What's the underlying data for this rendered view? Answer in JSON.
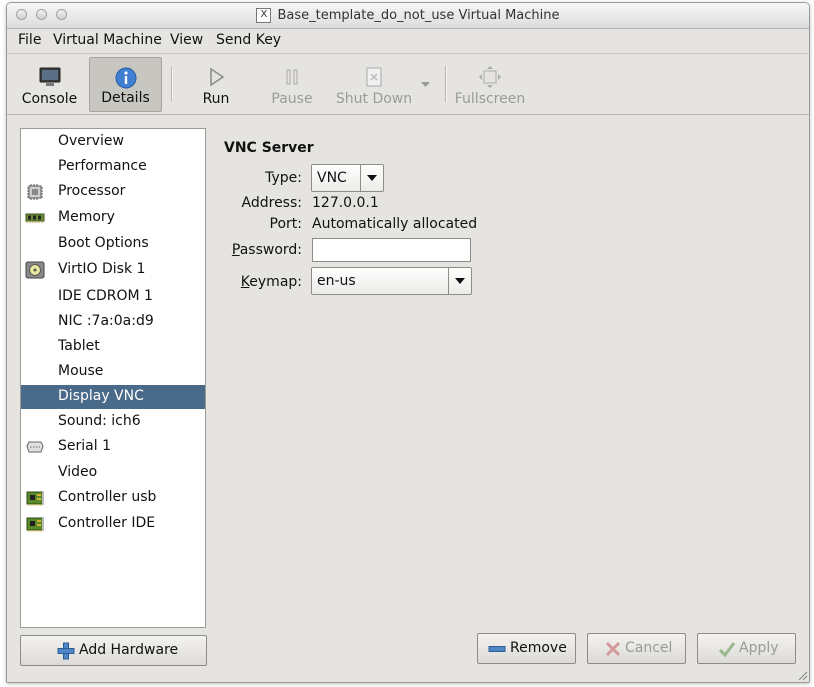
{
  "window": {
    "title": "Base_template_do_not_use Virtual Machine",
    "x_icon": "X"
  },
  "menu": {
    "file": "File",
    "virtual_machine": "Virtual Machine",
    "view": "View",
    "send_key": "Send Key"
  },
  "toolbar": {
    "console": "Console",
    "details": "Details",
    "run": "Run",
    "pause": "Pause",
    "shut_down": "Shut Down",
    "fullscreen": "Fullscreen"
  },
  "sidebar": {
    "items": [
      {
        "label": "Overview",
        "icon": "none"
      },
      {
        "label": "Performance",
        "icon": "none"
      },
      {
        "label": "Processor",
        "icon": "cpu-chip-icon"
      },
      {
        "label": "Memory",
        "icon": "memory-module-icon"
      },
      {
        "label": "Boot Options",
        "icon": "none"
      },
      {
        "label": "VirtIO Disk 1",
        "icon": "hard-disk-icon"
      },
      {
        "label": "IDE CDROM 1",
        "icon": "none"
      },
      {
        "label": "NIC :7a:0a:d9",
        "icon": "none"
      },
      {
        "label": "Tablet",
        "icon": "none"
      },
      {
        "label": "Mouse",
        "icon": "none"
      },
      {
        "label": "Display VNC",
        "icon": "none"
      },
      {
        "label": "Sound: ich6",
        "icon": "none"
      },
      {
        "label": "Serial 1",
        "icon": "serial-port-icon"
      },
      {
        "label": "Video",
        "icon": "none"
      },
      {
        "label": "Controller usb",
        "icon": "controller-card-icon"
      },
      {
        "label": "Controller IDE",
        "icon": "controller-card-icon"
      }
    ],
    "selected": "Display VNC"
  },
  "vnc": {
    "section_title": "VNC Server",
    "type_label": "Type:",
    "type_value": "VNC",
    "address_label": "Address:",
    "address_value": "127.0.0.1",
    "port_label": "Port:",
    "port_value": "Automatically allocated",
    "password_label": "Password:",
    "password_value": "",
    "keymap_label": "Keymap:",
    "keymap_value": "en-us"
  },
  "buttons": {
    "add_hardware": "Add Hardware",
    "remove": "Remove",
    "cancel": "Cancel",
    "apply": "Apply"
  },
  "colors": {
    "selection": "#4a6a8a",
    "window_bg": "#e6e4e0"
  }
}
